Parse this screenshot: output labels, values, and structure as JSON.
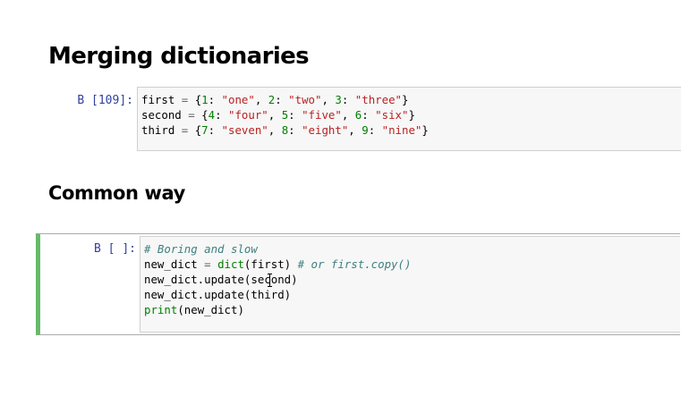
{
  "headings": {
    "merging": "Merging dictionaries",
    "common": "Common way"
  },
  "cells": [
    {
      "prompt": "В [109]:",
      "lines": [
        "first = {1: \"one\", 2: \"two\", 3: \"three\"}",
        "second = {4: \"four\", 5: \"five\", 6: \"six\"}",
        "third = {7: \"seven\", 8: \"eight\", 9: \"nine\"}"
      ]
    },
    {
      "prompt": "В [ ]:",
      "lines": [
        "# Boring and slow",
        "new_dict = dict(first) # or first.copy()",
        "new_dict.update(second)",
        "new_dict.update(third)",
        "print(new_dict)"
      ]
    }
  ],
  "colors": {
    "prompt": "#303f9f",
    "string": "#ba2121",
    "number": "#008000",
    "comment": "#408080",
    "active_cell_border": "#66bb6a",
    "input_background": "#f7f7f7"
  }
}
